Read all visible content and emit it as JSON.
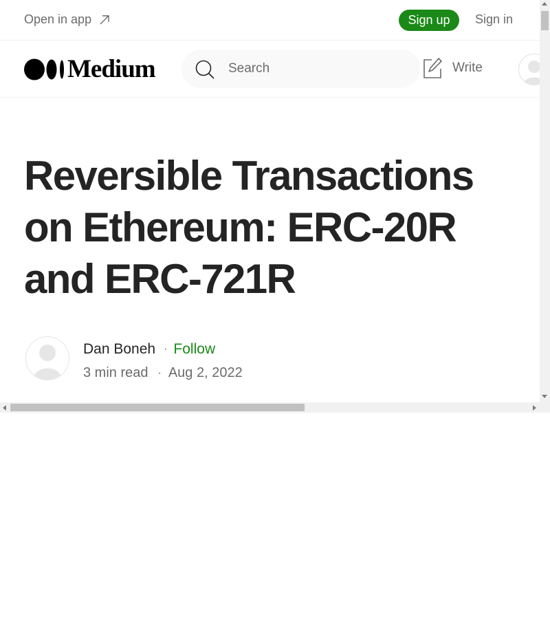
{
  "promo_bar": {
    "open_in_app": "Open in app",
    "sign_up": "Sign up",
    "sign_in": "Sign in"
  },
  "header": {
    "logo_text": "Medium",
    "search_placeholder": "Search",
    "write_label": "Write"
  },
  "article": {
    "title": "Reversible Transactions on Ethereum: ERC-20R and ERC-721R",
    "author_name": "Dan Boneh",
    "follow_label": "Follow",
    "read_time": "3 min read",
    "date": "Aug 2, 2022"
  },
  "colors": {
    "accent_green": "#1a8917",
    "text_primary": "#242424",
    "text_secondary": "#6b6b6b"
  },
  "icons": [
    "arrow-up-right-icon",
    "medium-logo-icon",
    "search-icon",
    "write-icon",
    "user-avatar-icon"
  ]
}
